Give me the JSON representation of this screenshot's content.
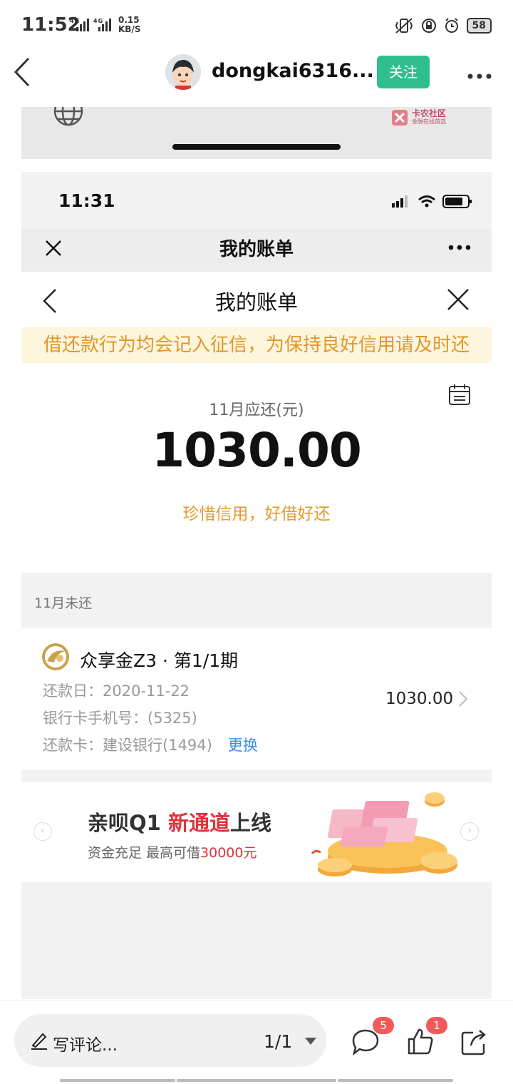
{
  "status_bar": {
    "time": "11:52",
    "network": "4G 4G",
    "speed_value": "0.15",
    "speed_unit": "KB/S",
    "battery": "58"
  },
  "header": {
    "username": "dongkai6316...",
    "follow_label": "关注"
  },
  "screenshot": {
    "status_time": "11:31",
    "wechat_title": "我的账单",
    "page_title": "我的账单",
    "notice": "借还款行为均会记入征信，为保持良好信用请及时还",
    "due_label": "11月应还(元)",
    "due_amount": "1030.00",
    "slogan": "珍惜信用，好借好还",
    "section_label": "11月未还",
    "bill": {
      "product": "众享金Z3 · 第1/1期",
      "repay_date": "还款日：2020-11-22",
      "bank_phone": "银行卡手机号：(5325)",
      "repay_card": "还款卡：建设银行(1494)",
      "change_label": "更换",
      "amount": "1030.00"
    },
    "banner": {
      "title_prefix": "亲呗Q1 ",
      "title_highlight": "新通道",
      "title_suffix": "上线",
      "sub_prefix": "资金充足 最高可借",
      "sub_highlight": "30000元"
    },
    "brand_text": "卡农社区",
    "brand_sub": "金融在线首选"
  },
  "bottom_bar": {
    "comment_placeholder": "写评论...",
    "page_indicator": "1/1",
    "comment_count": "5",
    "like_count": "1"
  },
  "colors": {
    "follow_green": "#2fbf8f",
    "notice_orange": "#e0972b",
    "link_blue": "#3a8ee6",
    "badge_red": "#f25a5a"
  }
}
